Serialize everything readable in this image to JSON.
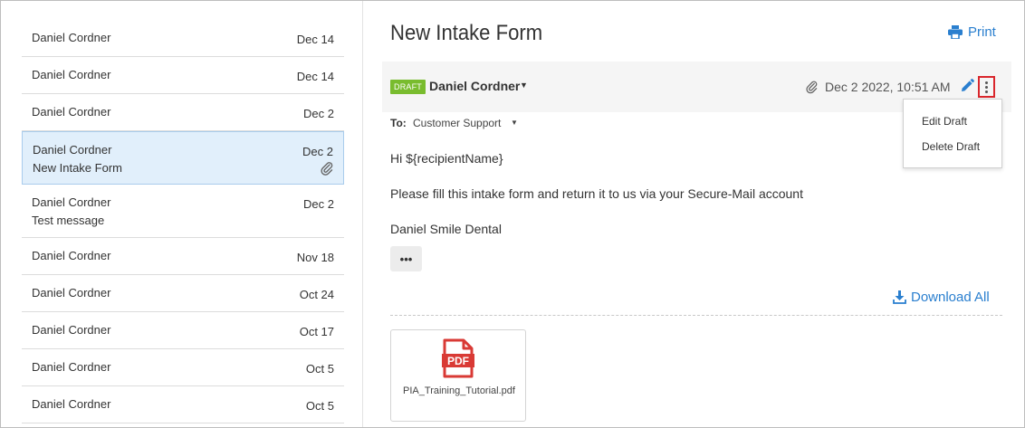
{
  "messages": [
    {
      "from": "Daniel Cordner",
      "date": "Dec 14",
      "subject": "",
      "attachment": false,
      "selected": false
    },
    {
      "from": "Daniel Cordner",
      "date": "Dec 14",
      "subject": "",
      "attachment": false,
      "selected": false
    },
    {
      "from": "Daniel Cordner",
      "date": "Dec 2",
      "subject": "",
      "attachment": false,
      "selected": false
    },
    {
      "from": "Daniel Cordner",
      "date": "Dec 2",
      "subject": "New Intake Form",
      "attachment": true,
      "selected": true
    },
    {
      "from": "Daniel Cordner",
      "date": "Dec 2",
      "subject": "Test message",
      "attachment": false,
      "selected": false
    },
    {
      "from": "Daniel Cordner",
      "date": "Nov 18",
      "subject": "",
      "attachment": false,
      "selected": false
    },
    {
      "from": "Daniel Cordner",
      "date": "Oct 24",
      "subject": "",
      "attachment": false,
      "selected": false
    },
    {
      "from": "Daniel Cordner",
      "date": "Oct 17",
      "subject": "",
      "attachment": false,
      "selected": false
    },
    {
      "from": "Daniel Cordner",
      "date": "Oct 5",
      "subject": "",
      "attachment": false,
      "selected": false
    },
    {
      "from": "Daniel Cordner",
      "date": "Oct 5",
      "subject": "",
      "attachment": false,
      "selected": false
    }
  ],
  "detail": {
    "title": "New Intake Form",
    "print_label": "Print",
    "badge": "DRAFT",
    "sender": "Daniel Cordner",
    "date": "Dec 2 2022, 10:51 AM",
    "to_label": "To:",
    "to_value": "Customer Support",
    "menu": {
      "edit": "Edit Draft",
      "delete": "Delete Draft"
    },
    "body": {
      "greeting": "Hi ${recipientName}",
      "paragraph": "Please fill this intake form and return it to us via your Secure-Mail account",
      "signature": "Daniel Smile Dental"
    },
    "more_label": "•••",
    "download_all_label": "Download All",
    "attachment": {
      "icon_text": "PDF",
      "filename": "PIA_Training_Tutorial.pdf"
    }
  },
  "colors": {
    "accent": "#2a7fcf",
    "draft_badge": "#79bc2e",
    "selected_bg": "#e1effb",
    "highlight_border": "#d9262c",
    "pdf_red": "#d93a35"
  },
  "icons": {
    "print": "printer-icon",
    "attachment": "paperclip-icon",
    "edit": "pencil-icon",
    "more": "vertical-ellipsis-icon",
    "download": "download-icon",
    "file": "pdf-file-icon"
  }
}
